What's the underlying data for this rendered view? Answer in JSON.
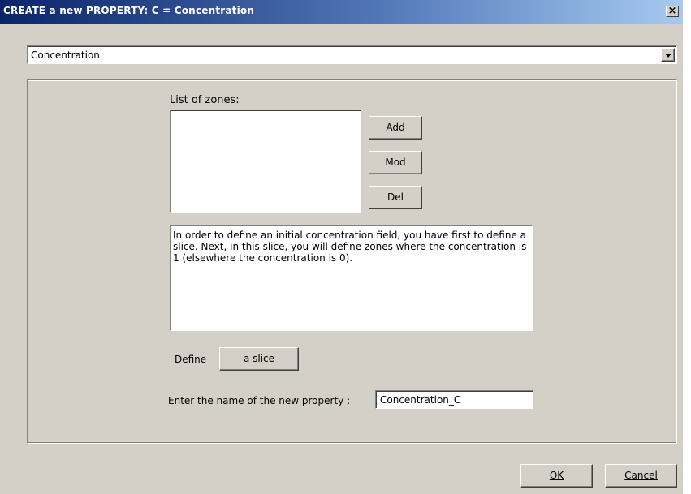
{
  "window": {
    "title": "CREATE a new PROPERTY: C = Concentration",
    "close_glyph": "×"
  },
  "property_type": {
    "selected": "Concentration"
  },
  "zones": {
    "label": "List of zones:",
    "items": [],
    "add_label": "Add",
    "mod_label": "Mod",
    "del_label": "Del"
  },
  "info": {
    "text": "In order to define an initial concentration field, you have first to define a slice. Next, in this slice, you will define zones where the concentration is 1 (elsewhere the concentration is 0)."
  },
  "define": {
    "label": "Define",
    "button_label": "a slice"
  },
  "new_property": {
    "label": "Enter the name of the new property :",
    "value": "Concentration_C"
  },
  "footer": {
    "ok_label": "OK",
    "cancel_label": "Cancel"
  },
  "colors": {
    "dialog_bg": "#d4d0c8",
    "titlebar_start": "#0a246a",
    "titlebar_end": "#a6caf0"
  }
}
